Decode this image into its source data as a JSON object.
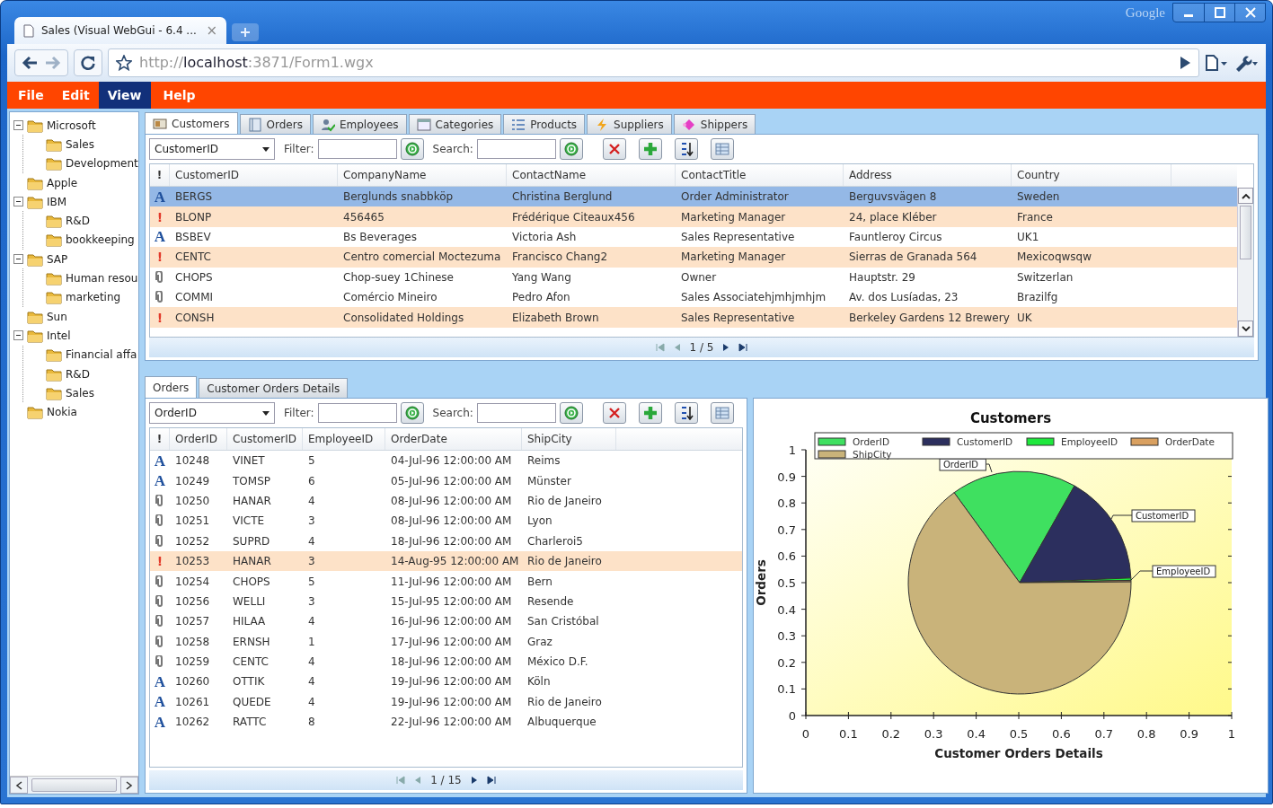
{
  "browser": {
    "tab_title": "Sales (Visual WebGui - 6.4 ...",
    "tab_close": "×",
    "brand": "Google",
    "url_scheme": "http://",
    "url_host": "localhost",
    "url_rest": ":3871/Form1.wgx"
  },
  "menu": [
    {
      "label": "File",
      "selected": false
    },
    {
      "label": "Edit",
      "selected": false
    },
    {
      "label": "View",
      "selected": true
    },
    {
      "label": "Help",
      "selected": false
    }
  ],
  "tree": [
    {
      "label": "Microsoft",
      "expanded": true,
      "children": [
        {
          "label": "Sales"
        },
        {
          "label": "Development"
        }
      ]
    },
    {
      "label": "Apple"
    },
    {
      "label": "IBM",
      "expanded": true,
      "children": [
        {
          "label": "R&D"
        },
        {
          "label": "bookkeeping"
        }
      ]
    },
    {
      "label": "SAP",
      "expanded": true,
      "children": [
        {
          "label": "Human resou"
        },
        {
          "label": "marketing"
        }
      ]
    },
    {
      "label": "Sun"
    },
    {
      "label": "Intel",
      "expanded": true,
      "children": [
        {
          "label": "Financial affa"
        },
        {
          "label": "R&D"
        },
        {
          "label": "Sales"
        }
      ]
    },
    {
      "label": "Nokia"
    }
  ],
  "top_panel": {
    "tabs": [
      {
        "label": "Customers",
        "kind": "card",
        "selected": true
      },
      {
        "label": "Orders",
        "kind": "book",
        "selected": false
      },
      {
        "label": "Employees",
        "kind": "people",
        "selected": false
      },
      {
        "label": "Categories",
        "kind": "window",
        "selected": false
      },
      {
        "label": "Products",
        "kind": "list",
        "selected": false
      },
      {
        "label": "Suppliers",
        "kind": "bolt",
        "selected": false
      },
      {
        "label": "Shippers",
        "kind": "gem",
        "selected": false
      }
    ],
    "toolbar": {
      "field": "CustomerID",
      "filter_label": "Filter:",
      "search_label": "Search:"
    },
    "grid": {
      "mark_header": "!",
      "columns": [
        "CustomerID",
        "CompanyName",
        "ContactName",
        "ContactTitle",
        "Address",
        "Country"
      ],
      "rows": [
        {
          "kind": "added",
          "mark": "A",
          "selected": true,
          "cells": [
            "BERGS",
            "Berglunds snabbköp",
            "Christina Berglund",
            "Order Administrator",
            "Berguvsvägen 8",
            "Sweden"
          ]
        },
        {
          "kind": "error",
          "mark": "!",
          "selected": false,
          "cells": [
            "BLONP",
            "456465",
            "Frédérique Citeaux456",
            "Marketing Manager",
            "24, place Kléber",
            "France"
          ]
        },
        {
          "kind": "added",
          "mark": "A",
          "selected": false,
          "cells": [
            "BSBEV",
            "Bs Beverages",
            "Victoria Ash",
            "Sales Representative",
            "Fauntleroy Circus",
            "UK1"
          ]
        },
        {
          "kind": "error",
          "mark": "!",
          "selected": false,
          "cells": [
            "CENTC",
            "Centro comercial Moctezuma",
            "Francisco Chang2",
            "Marketing Manager",
            "Sierras de Granada 564",
            "Mexicoqwsqw"
          ]
        },
        {
          "kind": "attached",
          "selected": false,
          "cells": [
            "CHOPS",
            "Chop-suey 1Chinese",
            "Yang Wang",
            "Owner",
            "Hauptstr. 29",
            "Switzerlan"
          ]
        },
        {
          "kind": "attached",
          "selected": false,
          "cells": [
            "COMMI",
            "Comércio Mineiro",
            "Pedro Afon",
            "Sales Associatehjmhjmhjm",
            "Av. dos Lusíadas, 23",
            "Brazilfg"
          ]
        },
        {
          "kind": "error",
          "mark": "!",
          "selected": false,
          "cells": [
            "CONSH",
            "Consolidated Holdings",
            "Elizabeth Brown",
            "Sales Representative",
            "Berkeley Gardens 12 Brewery",
            "UK"
          ]
        }
      ]
    },
    "pager": "1 / 5"
  },
  "bottom_panel": {
    "tabs": [
      {
        "label": "Orders",
        "selected": true
      },
      {
        "label": "Customer Orders Details",
        "selected": false
      }
    ],
    "toolbar": {
      "field": "OrderID",
      "filter_label": "Filter:",
      "search_label": "Search:"
    },
    "grid": {
      "mark_header": "!",
      "columns": [
        "OrderID",
        "CustomerID",
        "EmployeeID",
        "OrderDate",
        "ShipCity"
      ],
      "rows": [
        {
          "kind": "added",
          "mark": "A",
          "selected": false,
          "cells": [
            "10248",
            "VINET",
            "5",
            "04-Jul-96 12:00:00 AM",
            "Reims"
          ]
        },
        {
          "kind": "added",
          "mark": "A",
          "selected": false,
          "cells": [
            "10249",
            "TOMSP",
            "6",
            "05-Jul-96 12:00:00 AM",
            "Münster"
          ]
        },
        {
          "kind": "attached",
          "selected": false,
          "cells": [
            "10250",
            "HANAR",
            "4",
            "08-Jul-96 12:00:00 AM",
            "Rio de Janeiro"
          ]
        },
        {
          "kind": "attached",
          "selected": false,
          "cells": [
            "10251",
            "VICTE",
            "3",
            "08-Jul-96 12:00:00 AM",
            "Lyon"
          ]
        },
        {
          "kind": "attached",
          "selected": false,
          "cells": [
            "10252",
            "SUPRD",
            "4",
            "18-Jul-96 12:00:00 AM",
            "Charleroi5"
          ]
        },
        {
          "kind": "error",
          "mark": "!",
          "selected": false,
          "cells": [
            "10253",
            "HANAR",
            "3",
            "14-Aug-95 12:00:00 AM",
            "Rio de Janeiro"
          ]
        },
        {
          "kind": "attached",
          "selected": false,
          "cells": [
            "10254",
            "CHOPS",
            "5",
            "11-Jul-96 12:00:00 AM",
            "Bern"
          ]
        },
        {
          "kind": "attached",
          "selected": false,
          "cells": [
            "10256",
            "WELLI",
            "3",
            "15-Jul-95 12:00:00 AM",
            "Resende"
          ]
        },
        {
          "kind": "attached",
          "selected": false,
          "cells": [
            "10257",
            "HILAA",
            "4",
            "16-Jul-96 12:00:00 AM",
            "San Cristóbal"
          ]
        },
        {
          "kind": "attached",
          "selected": false,
          "cells": [
            "10258",
            "ERNSH",
            "1",
            "17-Jul-96 12:00:00 AM",
            "Graz"
          ]
        },
        {
          "kind": "attached",
          "selected": false,
          "cells": [
            "10259",
            "CENTC",
            "4",
            "18-Jul-96 12:00:00 AM",
            "México D.F."
          ]
        },
        {
          "kind": "added",
          "mark": "A",
          "selected": false,
          "cells": [
            "10260",
            "OTTIK",
            "4",
            "19-Jul-96 12:00:00 AM",
            "Köln"
          ]
        },
        {
          "kind": "added",
          "mark": "A",
          "selected": false,
          "cells": [
            "10261",
            "QUEDE",
            "4",
            "19-Jul-96 12:00:00 AM",
            "Rio de Janeiro"
          ]
        },
        {
          "kind": "added",
          "mark": "A",
          "selected": false,
          "cells": [
            "10262",
            "RATTC",
            "8",
            "22-Jul-96 12:00:00 AM",
            "Albuquerque"
          ]
        }
      ]
    },
    "pager": "1 / 15",
    "chart": {
      "title": "Customers",
      "y_title": "Orders",
      "x_title": "Customer Orders Details",
      "y_ticks": [
        "1",
        "0.9",
        "0.8",
        "0.7",
        "0.6",
        "0.5",
        "0.4",
        "0.3",
        "0.2",
        "0.1",
        "0"
      ],
      "x_ticks": [
        "0",
        "0.1",
        "0.2",
        "0.3",
        "0.4",
        "0.5",
        "0.6",
        "0.7",
        "0.8",
        "0.9",
        "1"
      ],
      "legend": [
        {
          "label": "OrderID",
          "color": "#3fe060"
        },
        {
          "label": "CustomerID",
          "color": "#2c2f5e"
        },
        {
          "label": "EmployeeID",
          "color": "#1ee83c"
        },
        {
          "label": "OrderDate",
          "color": "#d9a060"
        },
        {
          "label": "ShipCity",
          "color": "#c9b37a"
        }
      ],
      "callouts": [
        "OrderID",
        "CustomerID",
        "EmployeeID"
      ]
    }
  }
}
